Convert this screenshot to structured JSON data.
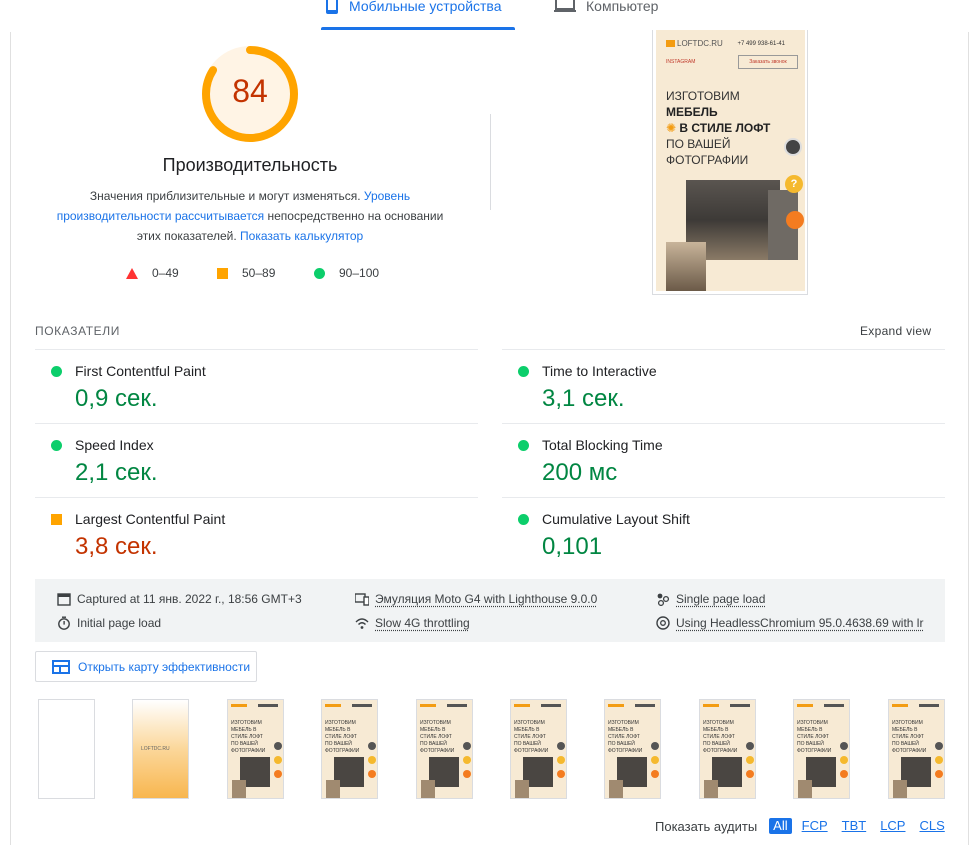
{
  "tabs": {
    "mobile_label": "Мобильные устройства",
    "desktop_label": "Компьютер"
  },
  "score": {
    "value": "84",
    "fraction": 0.84,
    "title": "Производительность",
    "desc_part1": "Значения приблизительные и могут изменяться. ",
    "desc_link1": "Уровень производительности рассчитывается",
    "desc_part2": " непосредственно на основании этих показателей. ",
    "desc_link2": "Показать калькулятор"
  },
  "legend": {
    "fail": "0–49",
    "average": "50–89",
    "pass": "90–100"
  },
  "screenshot": {
    "logo": "LOFTDC.RU",
    "phone": "+7 499 938-61-41",
    "instagram": "INSTAGRAM",
    "call_button": "Заказать звонок",
    "head_line1": "ИЗГОТОВИМ",
    "head_line2": "МЕБЕЛЬ",
    "head_line3": "В СТИЛЕ ЛОФТ",
    "head_line4": "ПО ВАШЕЙ",
    "head_line5": "ФОТОГРАФИИ",
    "help_glyph": "?"
  },
  "metrics": {
    "section_title": "ПОКАЗАТЕЛИ",
    "expand_label": "Expand view",
    "items": [
      {
        "name": "First Contentful Paint",
        "value": "0,9 сек.",
        "status": "pass"
      },
      {
        "name": "Time to Interactive",
        "value": "3,1 сек.",
        "status": "pass"
      },
      {
        "name": "Speed Index",
        "value": "2,1 сек.",
        "status": "pass"
      },
      {
        "name": "Total Blocking Time",
        "value": "200 мс",
        "status": "pass"
      },
      {
        "name": "Largest Contentful Paint",
        "value": "3,8 сек.",
        "status": "average"
      },
      {
        "name": "Cumulative Layout Shift",
        "value": "0,101",
        "status": "pass"
      }
    ]
  },
  "runtime": {
    "captured": "Captured at 11 янв. 2022 г., 18:56 GMT+3",
    "emulation": "Эмуляция Moto G4 with Lighthouse 9.0.0",
    "single_page": "Single page load",
    "initial_load": "Initial page load",
    "throttling": "Slow 4G throttling",
    "browser": "Using HeadlessChromium 95.0.4638.69 with lr"
  },
  "treemap_button": "Открыть карту эффективности",
  "filmstrip": {
    "frame2_logo": "LOFTDC.RU",
    "frame_text": "ИЗГОТОВИМ МЕБЕЛЬ В СТИЛЕ ЛОФТ ПО ВАШЕЙ ФОТОГРАФИИ"
  },
  "audits_filter": {
    "label": "Показать аудиты",
    "chips": [
      "All",
      "FCP",
      "TBT",
      "LCP",
      "CLS"
    ]
  },
  "colors": {
    "accent": "#1a73e8",
    "pass": "#0cce6b",
    "average": "#ffa400",
    "fail": "#ff3333"
  }
}
